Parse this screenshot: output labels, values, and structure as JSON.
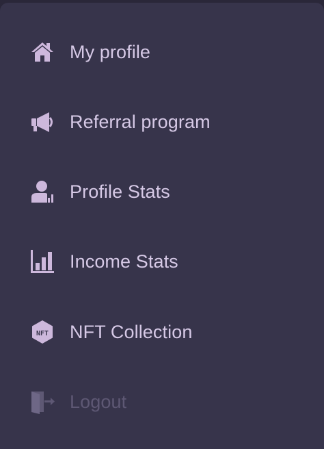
{
  "menu": {
    "items": [
      {
        "label": "My profile",
        "icon": "home-icon"
      },
      {
        "label": "Referral program",
        "icon": "megaphone-icon"
      },
      {
        "label": "Profile Stats",
        "icon": "user-stats-icon"
      },
      {
        "label": "Income Stats",
        "icon": "bar-chart-icon"
      },
      {
        "label": "NFT Collection",
        "icon": "nft-badge-icon"
      },
      {
        "label": "Logout",
        "icon": "logout-door-icon"
      }
    ]
  },
  "colors": {
    "panel": "#37344b",
    "text": "#d6c9e6",
    "icon": "#cdb8dc",
    "muted": "#5e5874"
  }
}
